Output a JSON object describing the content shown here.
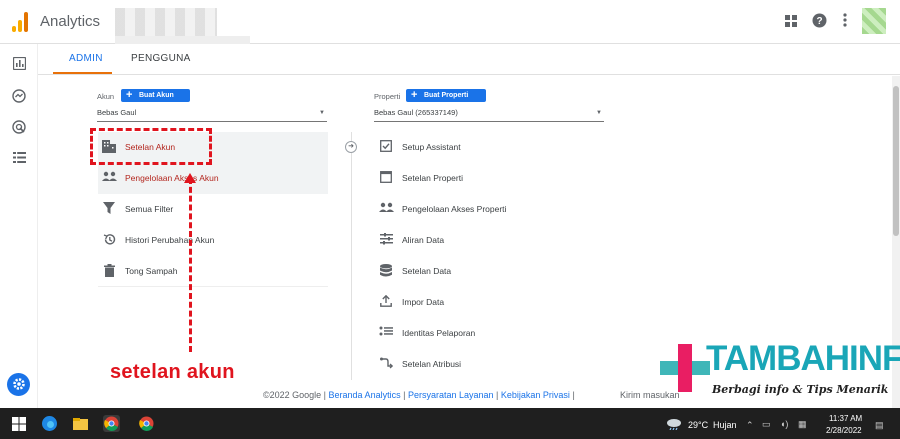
{
  "app": {
    "title": "Analytics"
  },
  "tabs": [
    {
      "label": "ADMIN",
      "active": true
    },
    {
      "label": "PENGGUNA",
      "active": false
    }
  ],
  "account": {
    "label": "Akun",
    "create_button": "Buat Akun",
    "selected": "Bebas Gaul",
    "items": [
      {
        "icon": "building-icon",
        "label": "Setelan Akun",
        "highlighted": true
      },
      {
        "icon": "people-icon",
        "label": "Pengelolaan Akses Akun",
        "highlighted": true
      },
      {
        "icon": "filter-icon",
        "label": "Semua Filter",
        "highlighted": false
      },
      {
        "icon": "history-icon",
        "label": "Histori Perubahan Akun",
        "highlighted": false
      },
      {
        "icon": "trash-icon",
        "label": "Tong Sampah",
        "highlighted": false
      }
    ]
  },
  "property": {
    "label": "Properti",
    "create_button": "Buat Properti",
    "selected": "Bebas Gaul (265337149)",
    "items": [
      {
        "icon": "checklist-icon",
        "label": "Setup Assistant"
      },
      {
        "icon": "window-icon",
        "label": "Setelan Properti"
      },
      {
        "icon": "people-icon",
        "label": "Pengelolaan Akses Properti"
      },
      {
        "icon": "data-stream-icon",
        "label": "Aliran Data"
      },
      {
        "icon": "database-icon",
        "label": "Setelan Data"
      },
      {
        "icon": "upload-icon",
        "label": "Impor Data"
      },
      {
        "icon": "id-icon",
        "label": "Identitas Pelaporan"
      },
      {
        "icon": "attribution-icon",
        "label": "Setelan Atribusi"
      }
    ]
  },
  "annotation": {
    "text": "setelan akun",
    "color": "#e0141e"
  },
  "footer": {
    "copyright": "©2022 Google |",
    "links": [
      "Beranda Analytics",
      "Persyaratan Layanan",
      "Kebijakan Privasi"
    ],
    "separator": "|",
    "feedback": "Kirim masukan"
  },
  "watermark": {
    "title": "TAMBAHINFO",
    "subtitle": "Berbagi info & Tips Menarik"
  },
  "taskbar": {
    "weather_temp": "29°C",
    "weather_text": "Hujan",
    "time": "11:37 AM",
    "date": "2/28/2022"
  },
  "colors": {
    "accent": "#1a73e8",
    "tab_underline": "#e8710a",
    "highlight_text": "#b3261e"
  }
}
